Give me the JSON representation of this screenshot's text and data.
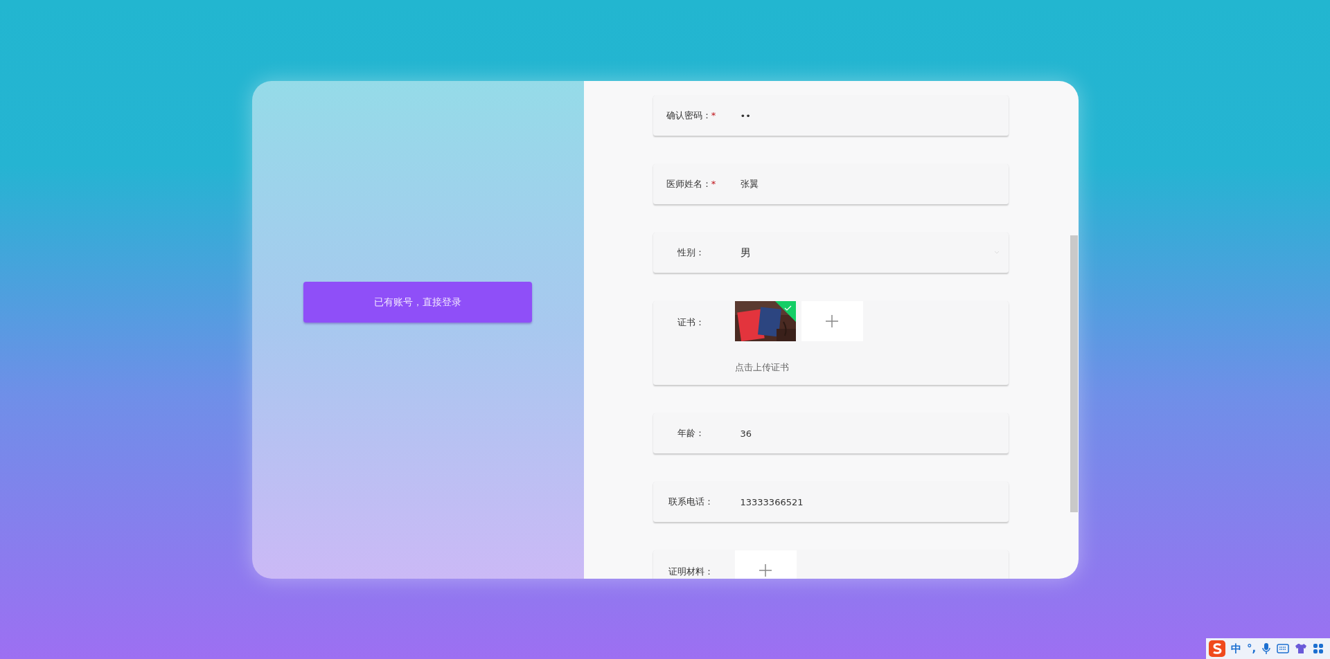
{
  "side_panel": {
    "login_button": "已有账号，直接登录"
  },
  "form": {
    "fields": [
      {
        "kind": "text",
        "label": "确认密码：",
        "required_mark": "*",
        "value": "••"
      },
      {
        "kind": "text",
        "label": "医师姓名：",
        "required_mark": "*",
        "value": "张翼"
      },
      {
        "kind": "select",
        "label": "性别：",
        "value": "男"
      },
      {
        "kind": "upload",
        "label": "证书：",
        "files": [
          {
            "kind": "picture",
            "uploaded": true
          }
        ],
        "hint": "点击上传证书"
      },
      {
        "kind": "text",
        "label": "年龄：",
        "value": "36"
      },
      {
        "kind": "text",
        "label": "联系电话：",
        "value": "13333366521"
      },
      {
        "kind": "upload",
        "label": "证明材料："
      }
    ]
  },
  "ime_toolbar": {
    "mode": "中",
    "punctuation": "°,"
  }
}
